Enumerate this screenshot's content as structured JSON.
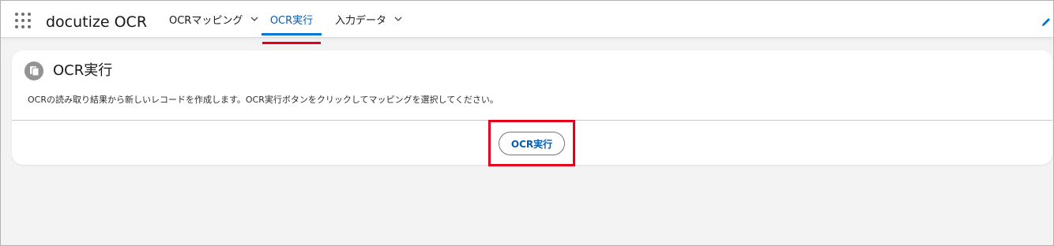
{
  "app": {
    "name": "docutize OCR"
  },
  "nav": {
    "items": [
      {
        "label": "OCRマッピング",
        "has_dropdown": true,
        "active": false
      },
      {
        "label": "OCR実行",
        "has_dropdown": false,
        "active": true
      },
      {
        "label": "入力データ",
        "has_dropdown": true,
        "active": false
      }
    ]
  },
  "card": {
    "title": "OCR実行",
    "description": "OCRの読み取り結果から新しいレコードを作成します。OCR実行ボタンをクリックしてマッピングを選択してください。",
    "button_label": "OCR実行"
  },
  "icons": {
    "launcher": "app-launcher-grid-icon",
    "card": "document-copy-icon",
    "chevron": "chevron-down-icon",
    "edit": "pencil-edit-icon"
  },
  "colors": {
    "active_tab": "#0176d3",
    "link_blue": "#0b5cab",
    "annotation_red": "#e2001a",
    "background": "#f3f3f3"
  }
}
